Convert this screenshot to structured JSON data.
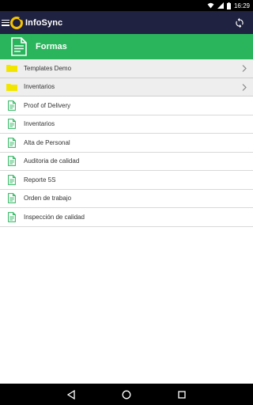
{
  "status_bar": {
    "time": "16:29"
  },
  "app_bar": {
    "title": "InfoSync"
  },
  "header": {
    "title": "Formas"
  },
  "folders": [
    {
      "label": "Templates Demo"
    },
    {
      "label": "Inventarios"
    }
  ],
  "forms": [
    {
      "label": "Proof of Delivery"
    },
    {
      "label": "Inventarios"
    },
    {
      "label": "Alta de Personal"
    },
    {
      "label": "Auditoria de calidad"
    },
    {
      "label": "Reporte 5S"
    },
    {
      "label": "Orden de trabajo"
    },
    {
      "label": "Inspección de calidad"
    }
  ],
  "colors": {
    "status_bar": "#000000",
    "app_bar": "#1f2240",
    "header_green": "#2ab55c",
    "folder_yellow": "#f2e600",
    "doc_green": "#2ab55c",
    "logo_yellow": "#f5c400"
  },
  "icons": {
    "menu": "menu-icon",
    "logo": "infosync-logo-icon",
    "sync": "sync-icon",
    "folder": "folder-icon",
    "document": "document-icon",
    "chevron": "chevron-right-icon",
    "nav_back": "back-triangle-icon",
    "nav_home": "home-circle-icon",
    "nav_recents": "recents-square-icon"
  }
}
